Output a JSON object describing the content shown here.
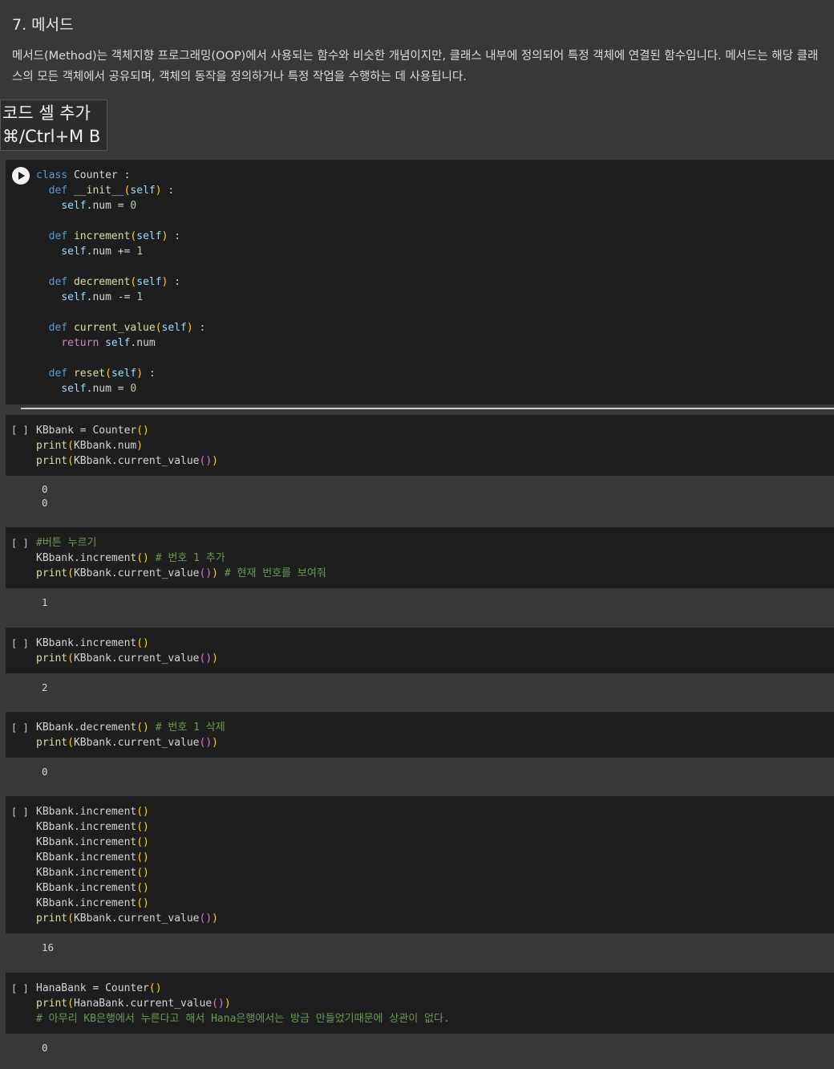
{
  "markdown": {
    "title": "7. 메서드",
    "body": "메서드(Method)는 객체지향 프로그래밍(OOP)에서 사용되는 함수와 비슷한 개념이지만, 클래스 내부에 정의되어 특정 객체에 연결된 함수입니다. 메서드는 해당 클래스의 모든 객체에서 공유되며, 객체의 동작을 정의하거나 특정 작업을 수행하는 데 사용됩니다."
  },
  "tooltip": {
    "line1": "코드 셀 추가",
    "line2": "⌘/Ctrl+M B"
  },
  "cells": [
    {
      "bracket": "",
      "output": ""
    },
    {
      "bracket": "[ ]",
      "output": "0\n0"
    },
    {
      "bracket": "[ ]",
      "output": "1"
    },
    {
      "bracket": "[ ]",
      "output": "2"
    },
    {
      "bracket": "[ ]",
      "output": "0"
    },
    {
      "bracket": "[ ]",
      "output": "16"
    },
    {
      "bracket": "[ ]",
      "output": "0"
    }
  ],
  "code": {
    "c0": {
      "class_kw": "class",
      "class_name": " Counter :",
      "def": "def",
      "init": "__init__",
      "self": "self",
      "num_attr": ".num = ",
      "zero": "0",
      "increment": "increment",
      "decrement": "decrement",
      "current_value": "current_value",
      "reset": "reset",
      "plus_eq": ".num += ",
      "minus_eq": ".num -= ",
      "one": "1",
      "return_kw": "return",
      "num_tail": ".num",
      "colon": " :"
    },
    "c1": {
      "line1": "KBbank = Counter",
      "line2": "print",
      "line2b": "KBbank.num",
      "line3": "print",
      "line3b": "KBbank.current_value"
    },
    "c2": {
      "comment1": "#버튼 누르기",
      "line2": "KBbank.increment",
      "comment2": " # 번호 1 추가",
      "line3": "print",
      "line3b": "KBbank.current_value",
      "comment3": " # 현재 번호를 보여줘"
    },
    "c3": {
      "line1": "KBbank.increment",
      "line2": "print",
      "line2b": "KBbank.current_value"
    },
    "c4": {
      "line1": "KBbank.decrement",
      "comment1": " # 번호 1 삭제",
      "line2": "print",
      "line2b": "KBbank.current_value"
    },
    "c5": {
      "inc": "KBbank.increment",
      "line8": "print",
      "line8b": "KBbank.current_value"
    },
    "c6": {
      "line1": "HanaBank = Counter",
      "line2": "print",
      "line2b": "HanaBank.current_value",
      "comment": "# 아무리 KB은행에서 누른다고 해서 Hana은행에서는 방금 만들었기때문에 상관이 없다."
    }
  }
}
